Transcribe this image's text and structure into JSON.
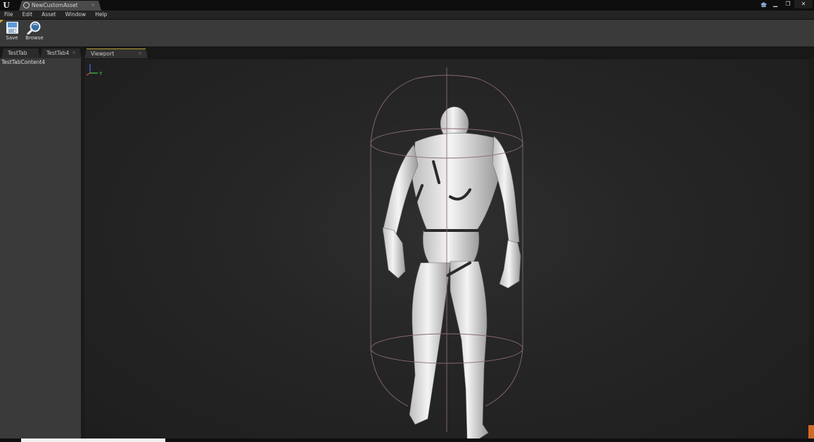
{
  "window": {
    "app_icon": "unreal-logo-icon",
    "document_tab": "NewCustomAsset",
    "document_tab_icon": "asset-circle-icon",
    "close_glyph": "×",
    "minimize_glyph": "▁",
    "restore_glyph": "❐",
    "window_close_glyph": "✕"
  },
  "menu": {
    "items": [
      "File",
      "Edit",
      "Asset",
      "Window",
      "Help"
    ]
  },
  "toolbar": {
    "save_label": "Save",
    "browse_label": "Browse"
  },
  "tabs": {
    "items": [
      {
        "label": "TestTab",
        "close": ""
      },
      {
        "label": "TestTab4",
        "close": "×"
      },
      {
        "label": "Viewport",
        "close": "×"
      }
    ]
  },
  "left_panel": {
    "content": "TestTabContent4"
  },
  "viewport": {
    "axis_label": "Y",
    "background": "#262626",
    "figure_color": "#efefef",
    "capsule_color": "#8a6a72"
  }
}
